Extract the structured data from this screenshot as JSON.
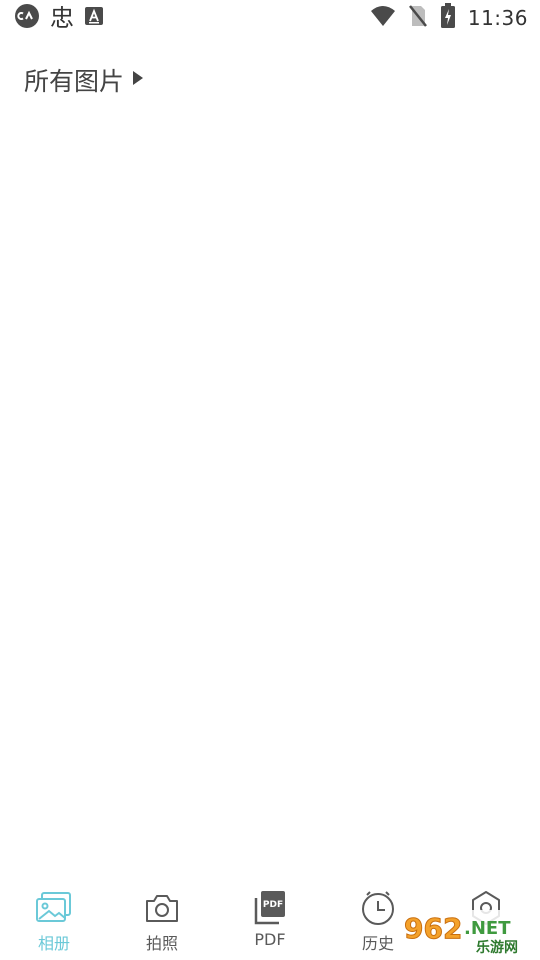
{
  "status_bar": {
    "time": "11:36",
    "bug_glyph": "忠",
    "icons": [
      "cloud-sync-icon",
      "notification-a-icon",
      "wifi-icon",
      "no-sim-icon",
      "battery-charging-icon"
    ]
  },
  "header": {
    "album_title": "所有图片"
  },
  "bottom_nav": {
    "active_color": "#6bc9d8",
    "items": [
      {
        "label": "相册",
        "icon": "album-icon",
        "active": true
      },
      {
        "label": "拍照",
        "icon": "camera-icon",
        "active": false
      },
      {
        "label": "PDF",
        "icon": "pdf-icon",
        "active": false
      },
      {
        "label": "历史",
        "icon": "history-icon",
        "active": false
      },
      {
        "label": "",
        "icon": "settings-icon",
        "active": false
      }
    ]
  },
  "watermark": {
    "number": "962",
    "suffix": ".NET",
    "subtitle": "乐游网"
  }
}
